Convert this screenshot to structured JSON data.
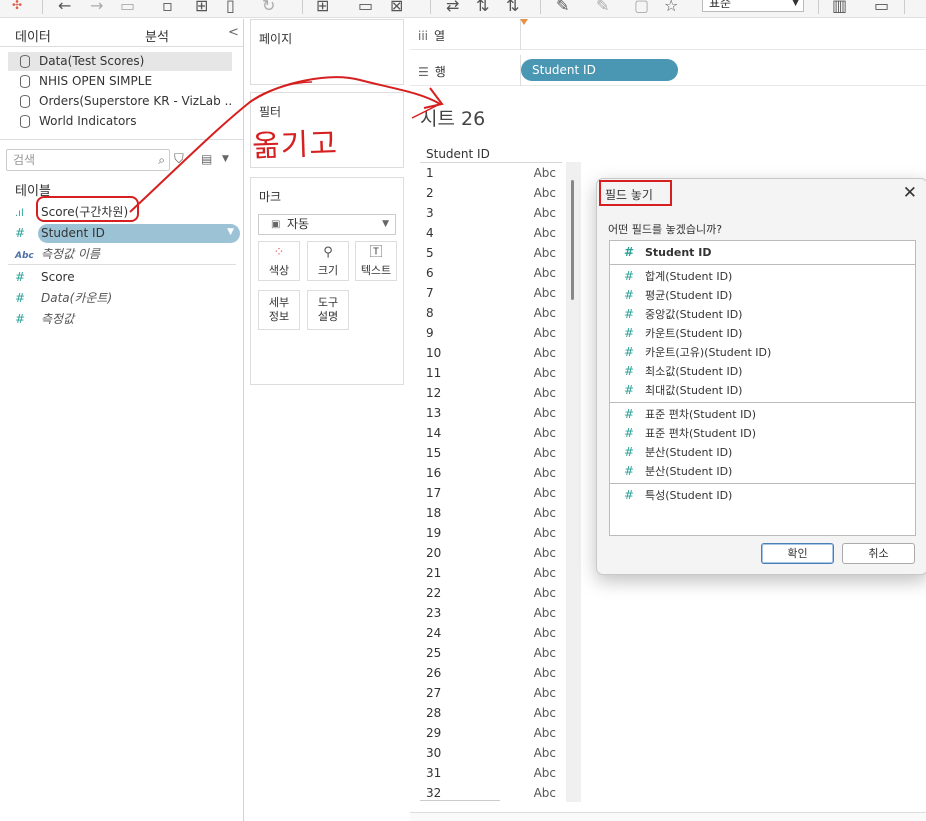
{
  "toolbar": {
    "font_value": "표준"
  },
  "left_pane": {
    "tabs": [
      "데이터",
      "분석"
    ],
    "data_sources": [
      {
        "label": "Data(Test Scores)",
        "selected": true
      },
      {
        "label": "NHIS OPEN SIMPLE",
        "selected": false
      },
      {
        "label": "Orders(Superstore KR - VizLab ...",
        "selected": false
      },
      {
        "label": "World Indicators",
        "selected": false
      }
    ],
    "search_placeholder": "검색",
    "tables_heading": "테이블",
    "dimension_fields": [
      {
        "label": "Score(구간차원)",
        "icon": "bins-icon"
      },
      {
        "label": "Student ID",
        "icon": "hash-icon"
      },
      {
        "label": "측정값 이름",
        "icon": "abc-icon"
      }
    ],
    "measure_fields": [
      {
        "label": "Score",
        "icon": "hash-icon"
      },
      {
        "label": "Data(카운트)",
        "icon": "hash-icon"
      },
      {
        "label": "측정값",
        "icon": "hash-icon"
      }
    ]
  },
  "shelves": {
    "pages": "페이지",
    "filters": "필터",
    "marks": "마크",
    "mark_type": "자동",
    "mark_buttons": [
      "색상",
      "크기",
      "텍스트"
    ],
    "mark_buttons_2": [
      [
        "세부",
        "정보"
      ],
      [
        "도구",
        "설명"
      ]
    ],
    "columns_label": "열",
    "rows_label": "행",
    "rows_pill": "Student ID"
  },
  "sheet": {
    "title": "시트 26",
    "column_header": "Student ID",
    "cell_value": "Abc",
    "row_ids": [
      "1",
      "2",
      "3",
      "4",
      "5",
      "6",
      "7",
      "8",
      "9",
      "10",
      "11",
      "12",
      "13",
      "14",
      "15",
      "16",
      "17",
      "18",
      "19",
      "20",
      "21",
      "22",
      "23",
      "24",
      "25",
      "26",
      "27",
      "28",
      "29",
      "30",
      "31",
      "32"
    ]
  },
  "dialog": {
    "title": "필드 놓기",
    "question": "어떤 필드를 놓겠습니까?",
    "header_option": "Student ID",
    "group1": [
      "합계(Student ID)",
      "평균(Student ID)",
      "중앙값(Student ID)",
      "카운트(Student ID)",
      "카운트(고유)(Student ID)",
      "최소값(Student ID)",
      "최대값(Student ID)"
    ],
    "group2": [
      "표준 편차(Student ID)",
      "표준 편차(Student ID)",
      "분산(Student ID)",
      "분산(Student ID)"
    ],
    "group3": [
      "특성(Student ID)"
    ],
    "ok_label": "확인",
    "cancel_label": "취소"
  },
  "annotation": {
    "text": "옮기고",
    "color": "#d62020"
  },
  "colors": {
    "pill_teal": "#4a97b4",
    "pill_light": "#9cc3d5",
    "measure_green": "#2aa198",
    "annotation_red": "#d62020"
  }
}
